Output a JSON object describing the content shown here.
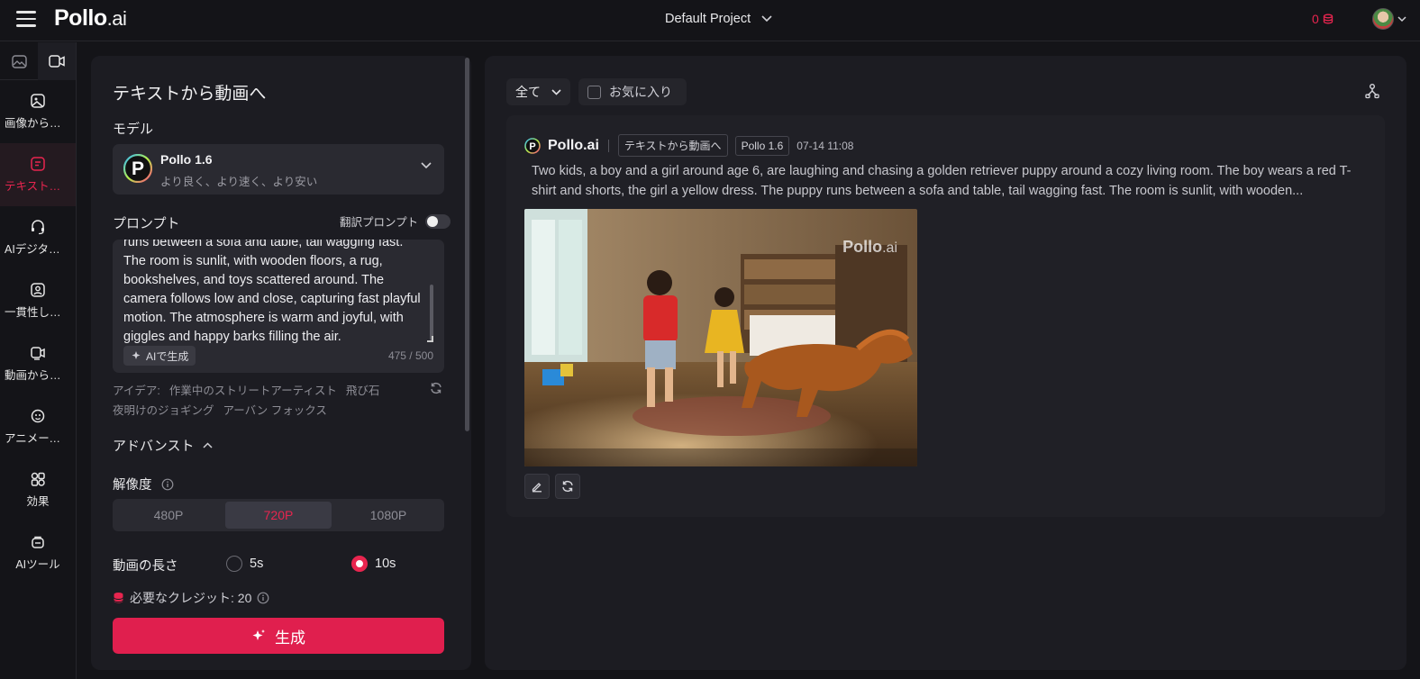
{
  "app": {
    "logo": "Pollo",
    "logo_suffix": ".ai",
    "project": "Default Project",
    "credits": "0"
  },
  "nav": {
    "items": [
      {
        "label": "画像から動画へ"
      },
      {
        "label": "テキストから動画へ"
      },
      {
        "label": "AIデジタルヒューマン"
      },
      {
        "label": "一貫性した動画"
      },
      {
        "label": "動画から動画へ"
      },
      {
        "label": "アニメーション"
      },
      {
        "label": "効果"
      },
      {
        "label": "AIツール"
      }
    ]
  },
  "panel": {
    "title": "テキストから動画へ",
    "model_label": "モデル",
    "model_name": "Pollo 1.6",
    "model_sub": "より良く、より速く、より安い",
    "prompt_label": "プロンプト",
    "translate_label": "翻訳プロンプト",
    "prompt_text": "runs between a sofa and table, tail wagging fast. The room is sunlit, with wooden floors, a rug, bookshelves, and toys scattered around. The camera follows low and close, capturing fast playful motion. The atmosphere is warm and joyful, with giggles and happy barks filling the air.",
    "ai_gen": "AIで生成",
    "char_count": "475 / 500",
    "ideas_label": "アイデア:",
    "ideas": [
      "作業中のストリートアーティスト",
      "飛び石",
      "夜明けのジョギング",
      "アーバン フォックス"
    ],
    "advanced": "アドバンスト",
    "resolution_label": "解像度",
    "resolutions": [
      "480P",
      "720P",
      "1080P"
    ],
    "selected_resolution": "720P",
    "duration_label": "動画の長さ",
    "duration_5": "5s",
    "duration_10": "10s",
    "selected_duration": "10s",
    "credit_text": "必要なクレジット: 20",
    "generate": "生成"
  },
  "right": {
    "filter": "全て",
    "favorites": "お気に入り",
    "card": {
      "brand": "Pollo.ai",
      "mode": "テキストから動画へ",
      "model": "Pollo 1.6",
      "time": "07-14 11:08",
      "description": "Two kids, a boy and a girl around age 6, are laughing and chasing a golden retriever puppy around a cozy living room. The boy wears a red T-shirt and shorts, the girl a yellow dress. The puppy runs between a sofa and table, tail wagging fast. The room is sunlit, with wooden...",
      "watermark": "Pollo",
      "watermark_suffix": ".ai"
    }
  },
  "colors": {
    "accent": "#e8254f",
    "panel": "#1c1c22",
    "background": "#141418"
  },
  "icons": [
    "menu-icon",
    "chevron-down-icon",
    "coin-icon",
    "image-icon",
    "video-icon",
    "image-to-video-icon",
    "text-to-video-icon",
    "digital-human-icon",
    "consistent-video-icon",
    "video-to-video-icon",
    "animation-icon",
    "effects-icon",
    "ai-tools-icon",
    "sparkle-icon",
    "refresh-icon",
    "info-icon",
    "chevron-up-icon",
    "share-icon",
    "edit-icon",
    "regenerate-icon"
  ]
}
